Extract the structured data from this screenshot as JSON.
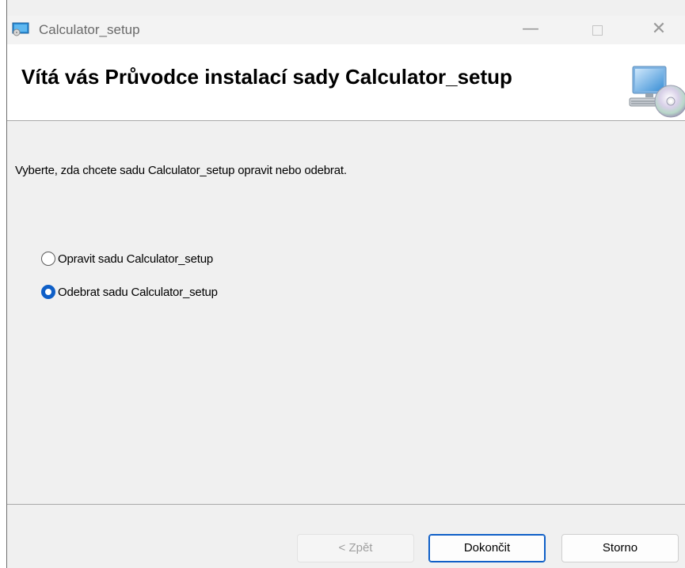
{
  "window": {
    "title": "Calculator_setup",
    "minimize_glyph": "—",
    "close_glyph": "✕"
  },
  "header": {
    "title": "Vítá vás Průvodce instalací sady Calculator_setup",
    "icon": "computer-cd-icon"
  },
  "content": {
    "instruction": "Vyberte, zda chcete sadu Calculator_setup opravit nebo odebrat.",
    "options": [
      {
        "label": "Opravit sadu Calculator_setup",
        "selected": false
      },
      {
        "label": "Odebrat sadu Calculator_setup",
        "selected": true
      }
    ]
  },
  "buttons": {
    "back": "< Zpět",
    "finish": "Dokončit",
    "cancel": "Storno"
  },
  "colors": {
    "accent": "#0f5fc7"
  }
}
